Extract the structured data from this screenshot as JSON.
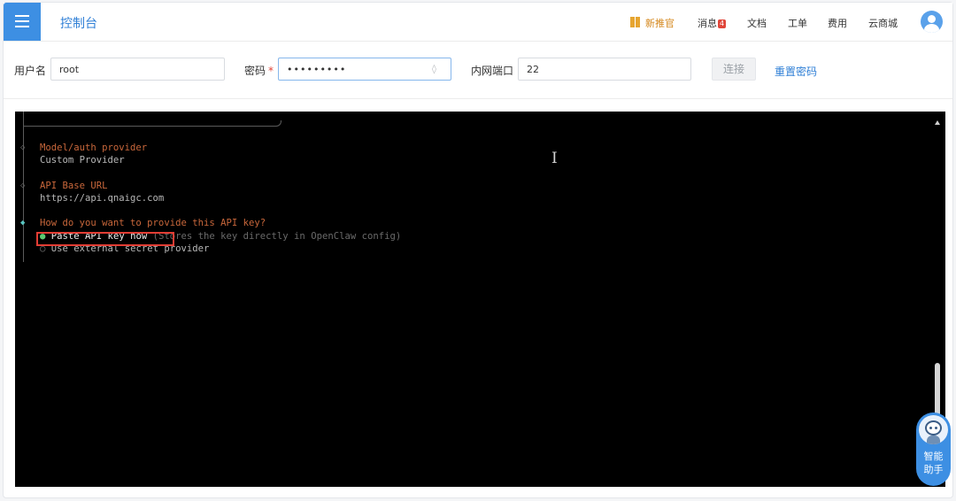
{
  "header": {
    "title": "控制台",
    "nav": {
      "promo": "新推官",
      "messages": "消息",
      "messages_badge": "4",
      "docs": "文档",
      "tickets": "工单",
      "billing": "费用",
      "marketplace": "云商城"
    }
  },
  "connection": {
    "username_label": "用户名",
    "username_value": "root",
    "password_label": "密码",
    "password_required": "*",
    "password_value": "•••••••••",
    "port_label": "内网端口",
    "port_value": "22",
    "connect_label": "连接",
    "reset_label": "重置密码"
  },
  "terminal": {
    "q1": "Model/auth provider",
    "a1": "Custom Provider",
    "q2": "API Base URL",
    "a2": "https://api.qnaigc.com",
    "q3": "How do you want to provide this API key?",
    "opt1_bullet": "●",
    "opt1": "Paste API key now",
    "opt1_hint": "(Stores the key directly in OpenClaw config)",
    "opt2_bullet": "○",
    "opt2": "Use external secret provider"
  },
  "assistant": {
    "line1": "智能",
    "line2": "助手"
  },
  "colors": {
    "primary": "#3d8fe3",
    "terminal_bg": "#000000",
    "prompt_orange": "#c9673b",
    "highlight_red": "#e23d34"
  }
}
